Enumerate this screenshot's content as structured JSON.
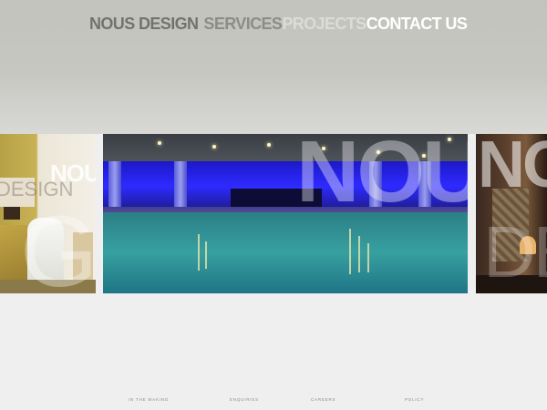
{
  "nav": {
    "logo": "NOUS DESIGN",
    "items": [
      "SERVICES",
      "PROJECTS",
      "CONTACT US"
    ]
  },
  "gallery": {
    "left": {
      "word1": "NOUS",
      "word2": "DESIGN",
      "letters": "GN"
    },
    "middle": {
      "word1": "NOUS"
    },
    "right": {
      "word1": "NOUS",
      "word2": "DE"
    }
  },
  "footer": {
    "links": [
      "IN THE MAKING",
      "ENQUIRIES",
      "CAREERS",
      "POLICY"
    ]
  },
  "colors": {
    "header_bg": "#c7c7c2",
    "body_bg": "#efeff0",
    "nav_logo": "#727270",
    "nav_services": "#8c8c89",
    "nav_projects": "#dcdcd8",
    "nav_contact": "#ffffff"
  }
}
